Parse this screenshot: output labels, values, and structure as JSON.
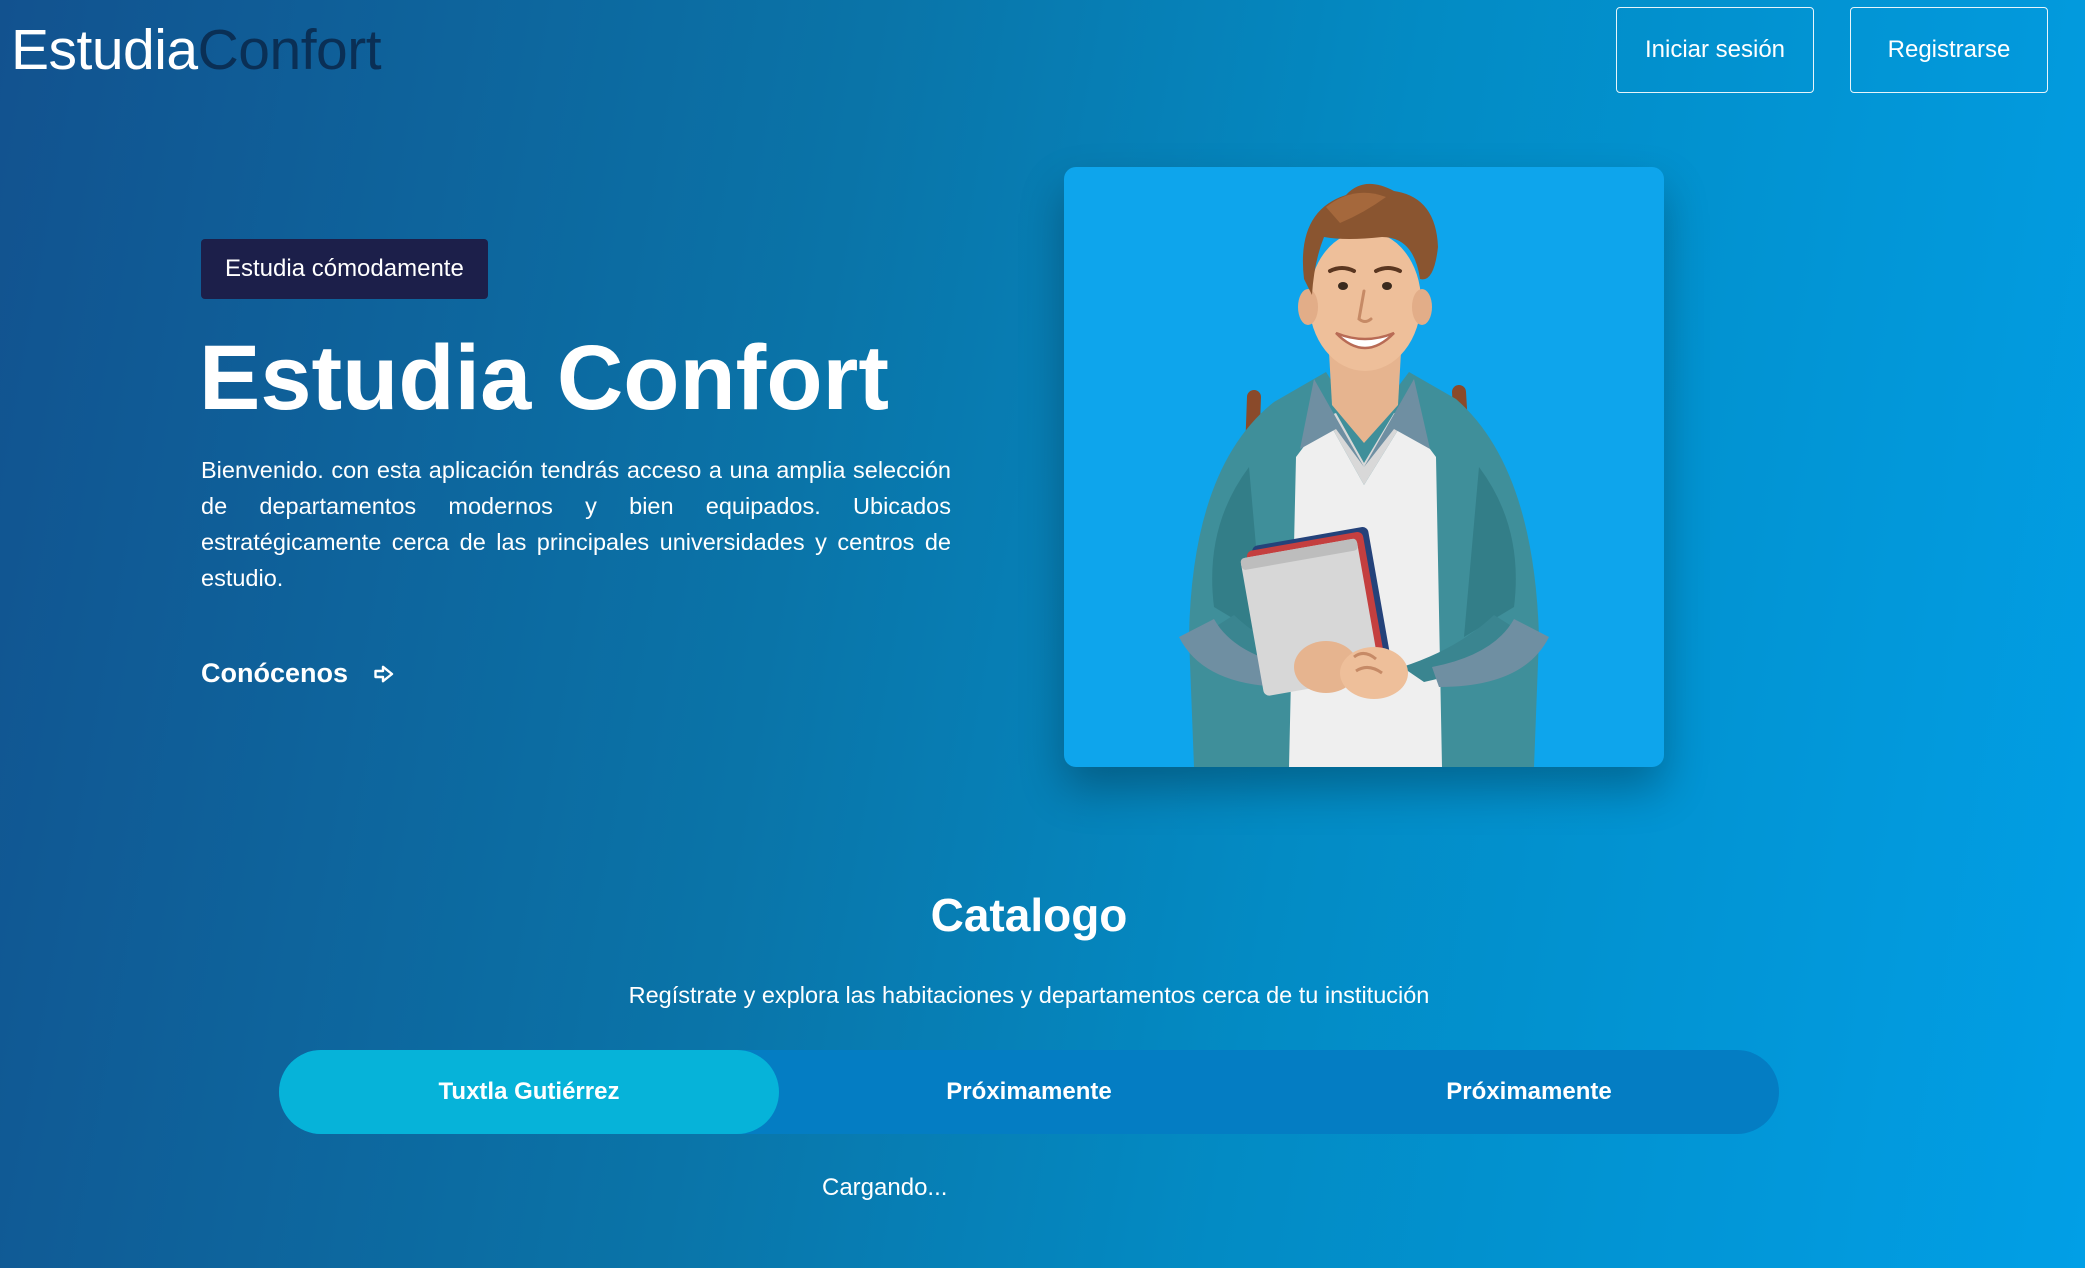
{
  "header": {
    "logo_part1": "Estudia",
    "logo_part2": "Confort",
    "login_label": "Iniciar sesión",
    "register_label": "Registrarse"
  },
  "hero": {
    "tagline": "Estudia cómodamente",
    "title": "Estudia Confort",
    "description": "Bienvenido. con esta aplicación tendrás acceso a una amplia selección de departamentos modernos y bien equipados. Ubicados estratégicamente cerca de las principales universidades y centros de estudio.",
    "link_label": "Conócenos",
    "link_icon": "arrow-right-icon"
  },
  "catalog": {
    "title": "Catalogo",
    "subtitle": "Regístrate y explora las habitaciones y departamentos cerca de tu institución",
    "tabs": [
      {
        "label": "Tuxtla Gutiérrez",
        "active": true
      },
      {
        "label": "Próximamente",
        "active": false
      },
      {
        "label": "Próximamente",
        "active": false
      }
    ],
    "status": "Cargando..."
  },
  "colors": {
    "logo_accent": "#0a2f55",
    "tagline_bg": "#1c1f4a",
    "tab_active": "#06b3d9",
    "tab_bar": "#047dc3",
    "card_bg": "#0ea5ec"
  }
}
